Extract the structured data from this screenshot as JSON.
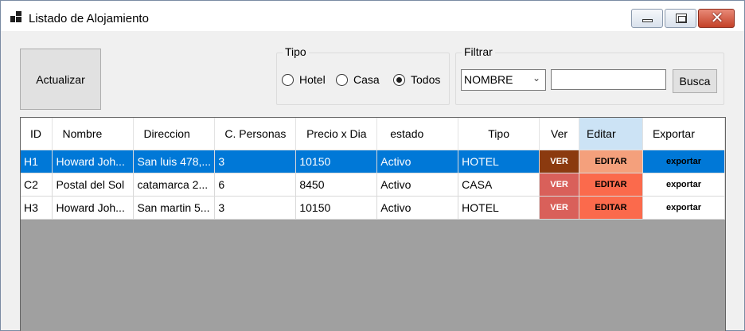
{
  "window": {
    "title": "Listado de Alojamiento"
  },
  "toolbar": {
    "actualizar_label": "Actualizar"
  },
  "tipo": {
    "title": "Tipo",
    "options": [
      {
        "label": "Hotel",
        "selected": false
      },
      {
        "label": "Casa",
        "selected": false
      },
      {
        "label": "Todos",
        "selected": true
      }
    ]
  },
  "filtrar": {
    "title": "Filtrar",
    "field_selected": "NOMBRE",
    "search_value": "",
    "busca_label": "Busca"
  },
  "grid": {
    "headers": [
      "ID",
      "Nombre",
      "Direccion",
      "C. Personas",
      "Precio x Dia",
      "estado",
      "Tipo",
      "Ver",
      "Editar",
      "Exportar"
    ],
    "rows": [
      {
        "id": "H1",
        "nombre": "Howard Joh...",
        "direccion": "San luis 478,...",
        "personas": "3",
        "precio": "10150",
        "estado": "Activo",
        "tipo": "HOTEL",
        "ver": "VER",
        "editar": "EDITAR",
        "exportar": "exportar",
        "selected": true
      },
      {
        "id": "C2",
        "nombre": "Postal del Sol",
        "direccion": "catamarca 2...",
        "personas": "6",
        "precio": "8450",
        "estado": "Activo",
        "tipo": "CASA",
        "ver": "VER",
        "editar": "EDITAR",
        "exportar": "exportar",
        "selected": false
      },
      {
        "id": "H3",
        "nombre": "Howard Joh...",
        "direccion": "San martin 5...",
        "personas": "3",
        "precio": "10150",
        "estado": "Activo",
        "tipo": "HOTEL",
        "ver": "VER",
        "editar": "EDITAR",
        "exportar": "exportar",
        "selected": false
      }
    ]
  },
  "colors": {
    "selection": "#0078d7",
    "ver_selected": "#8b3a0f",
    "ver_normal": "#d9605a",
    "editar_selected": "#f4a07c",
    "editar_normal": "#fb6a4c",
    "grid_background": "#a0a0a0"
  }
}
